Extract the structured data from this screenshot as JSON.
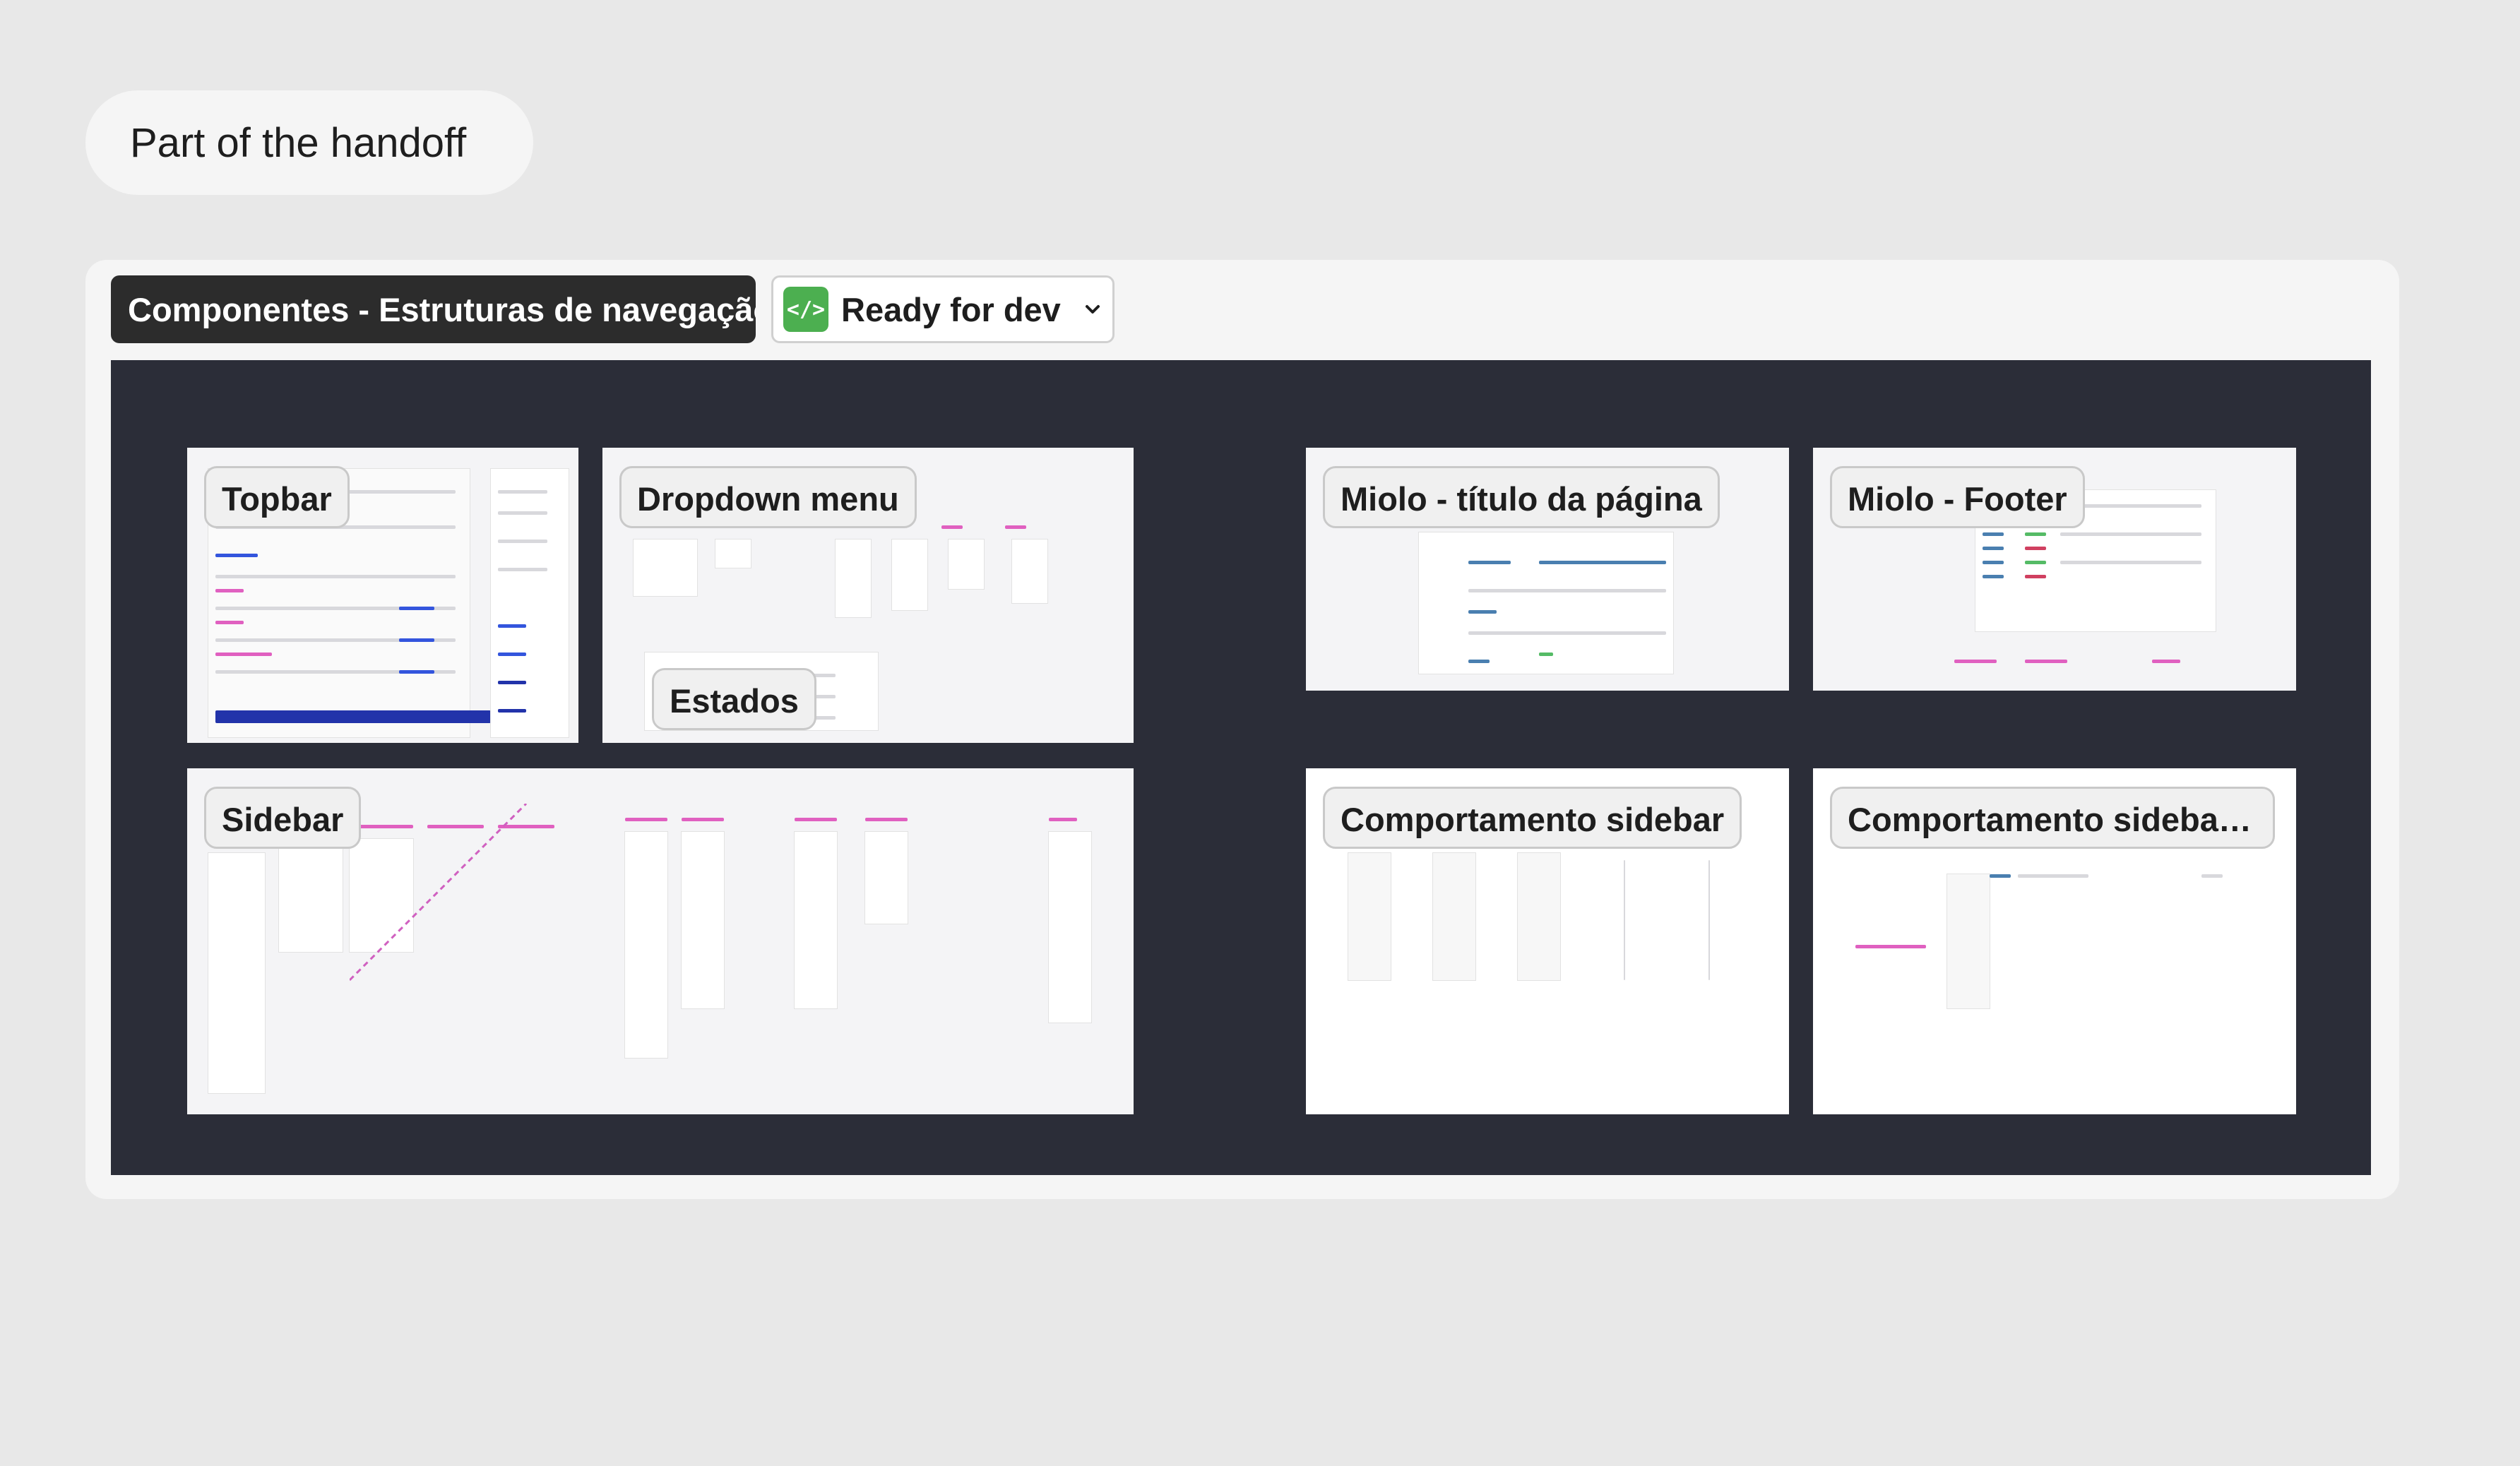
{
  "page": {
    "section_label": "Part of the handoff"
  },
  "card": {
    "title": "Componentes - Estruturas de navegação",
    "status": {
      "label": "Ready for dev",
      "icon": "code-icon",
      "color": "#4caf50"
    }
  },
  "frames": {
    "topbar": "Topbar",
    "dropdown": "Dropdown menu",
    "estados": "Estados",
    "miolo_titulo": "Miolo - título da página",
    "miolo_footer": "Miolo - Footer",
    "sidebar": "Sidebar",
    "comportamento_sidebar": "Comportamento sidebar",
    "comportamento_sidebar_plus": "Comportamento sidebar+..."
  },
  "colors": {
    "background": "#e8e8e8",
    "board": "#2b2d38",
    "title_chip": "#2c2c2c"
  }
}
